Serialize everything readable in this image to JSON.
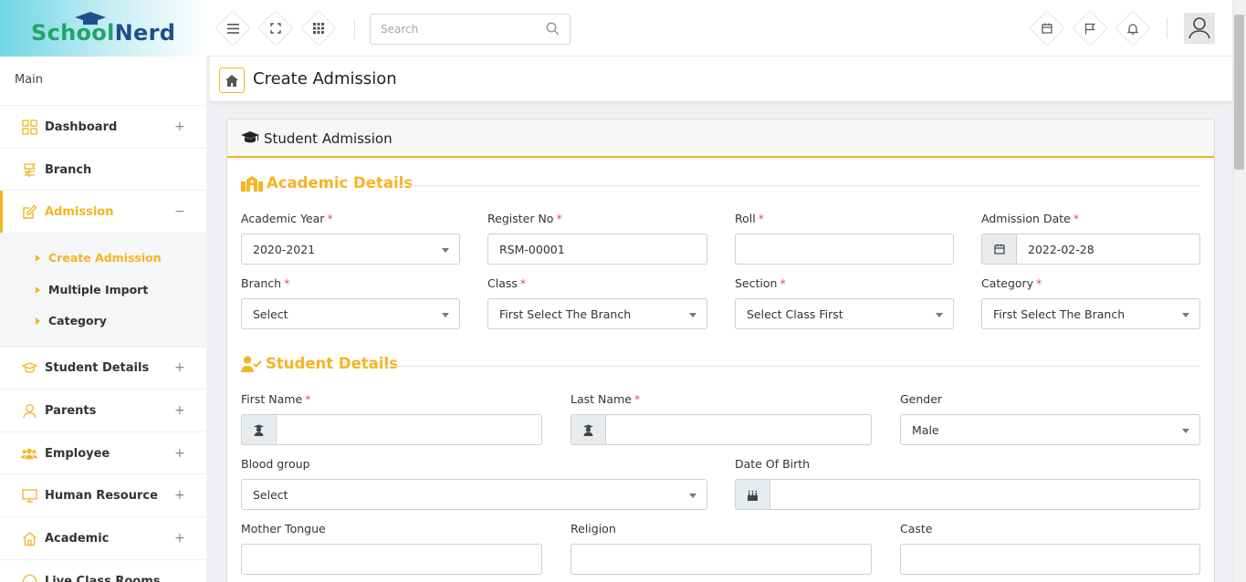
{
  "brand": {
    "school": "School",
    "nerd": "Nerd"
  },
  "search": {
    "placeholder": "Search"
  },
  "sidebar": {
    "main_label": "Main",
    "items": [
      {
        "label": "Dashboard",
        "icon": "dashboard-grid-icon"
      },
      {
        "label": "Branch",
        "icon": "branch-sign-icon"
      },
      {
        "label": "Admission",
        "icon": "edit-icon"
      },
      {
        "label": "Student Details",
        "icon": "graduation-cap-icon"
      },
      {
        "label": "Parents",
        "icon": "user-icon"
      },
      {
        "label": "Employee",
        "icon": "users-icon"
      },
      {
        "label": "Human Resource",
        "icon": "monitor-icon"
      },
      {
        "label": "Academic",
        "icon": "home-icon"
      },
      {
        "label": "Live Class Rooms",
        "icon": "circle-icon"
      }
    ],
    "submenu": [
      "Create Admission",
      "Multiple Import",
      "Category"
    ]
  },
  "page": {
    "title": "Create Admission"
  },
  "panel": {
    "title": "Student Admission"
  },
  "academic": {
    "title": "Academic Details",
    "academic_year": {
      "label": "Academic Year",
      "value": "2020-2021"
    },
    "register_no": {
      "label": "Register No",
      "value": "RSM-00001"
    },
    "roll": {
      "label": "Roll",
      "value": ""
    },
    "admission_date": {
      "label": "Admission Date",
      "value": "2022-02-28"
    },
    "branch": {
      "label": "Branch",
      "value": "Select"
    },
    "class": {
      "label": "Class",
      "value": "First Select The Branch"
    },
    "section": {
      "label": "Section",
      "value": "Select Class First"
    },
    "category": {
      "label": "Category",
      "value": "First Select The Branch"
    }
  },
  "student": {
    "title": "Student Details",
    "first_name": {
      "label": "First Name",
      "value": ""
    },
    "last_name": {
      "label": "Last Name",
      "value": ""
    },
    "gender": {
      "label": "Gender",
      "value": "Male"
    },
    "blood_group": {
      "label": "Blood group",
      "value": "Select"
    },
    "dob": {
      "label": "Date Of Birth",
      "value": ""
    },
    "mother_tongue": {
      "label": "Mother Tongue",
      "value": ""
    },
    "religion": {
      "label": "Religion",
      "value": ""
    },
    "caste": {
      "label": "Caste",
      "value": ""
    }
  },
  "colors": {
    "accent": "#f5b422",
    "required": "#d9534f"
  }
}
